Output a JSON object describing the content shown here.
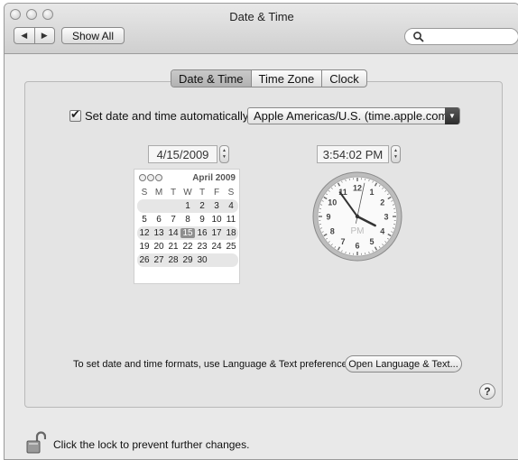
{
  "window": {
    "title": "Date & Time"
  },
  "toolbar": {
    "back_glyph": "◀",
    "forward_glyph": "▶",
    "show_all_label": "Show All",
    "search_placeholder": ""
  },
  "tabs": [
    {
      "label": "Date & Time",
      "active": true
    },
    {
      "label": "Time Zone",
      "active": false
    },
    {
      "label": "Clock",
      "active": false
    }
  ],
  "auto": {
    "checked": true,
    "label": "Set date and time automatically:",
    "server": "Apple Americas/U.S. (time.apple.com)"
  },
  "date_field": {
    "value": "4/15/2009"
  },
  "time_field": {
    "value": "3:54:02 PM"
  },
  "calendar": {
    "month_label": "April 2009",
    "weekdays": [
      "S",
      "M",
      "T",
      "W",
      "T",
      "F",
      "S"
    ],
    "weeks": [
      [
        "",
        "",
        "",
        "1",
        "2",
        "3",
        "4"
      ],
      [
        "5",
        "6",
        "7",
        "8",
        "9",
        "10",
        "11"
      ],
      [
        "12",
        "13",
        "14",
        "15",
        "16",
        "17",
        "18"
      ],
      [
        "19",
        "20",
        "21",
        "22",
        "23",
        "24",
        "25"
      ],
      [
        "26",
        "27",
        "28",
        "29",
        "30",
        "",
        ""
      ]
    ],
    "selected_day": "15"
  },
  "clock": {
    "numbers": [
      "12",
      "1",
      "2",
      "3",
      "4",
      "5",
      "6",
      "7",
      "8",
      "9",
      "10",
      "11"
    ],
    "meridiem": "PM",
    "hour": 3,
    "minute": 54,
    "second": 2
  },
  "footer": {
    "formats_text": "To set date and time formats, use Language & Text preferences.",
    "language_button": "Open Language & Text...",
    "help_label": "?",
    "lock_text": "Click the lock to prevent further changes."
  },
  "icons": {
    "lock": "open-lock-icon",
    "search": "search-icon",
    "help": "help-icon"
  }
}
